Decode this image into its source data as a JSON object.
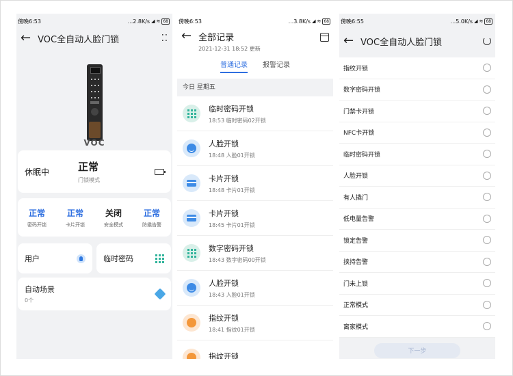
{
  "panel1": {
    "status": {
      "left": "傍晚6:53",
      "right": "...2.8K/s",
      "battery": "68"
    },
    "title": "VOC全自动人脸门锁",
    "brand": "VOC",
    "sleep": {
      "label": "休眠中",
      "value": "正常",
      "sub": "门锁模式"
    },
    "modes": [
      {
        "value": "正常",
        "label": "密码开锁",
        "color": "#2f6fe0"
      },
      {
        "value": "正常",
        "label": "卡片开锁",
        "color": "#2f6fe0"
      },
      {
        "value": "关闭",
        "label": "安全模式",
        "color": "#222222"
      },
      {
        "value": "正常",
        "label": "防撬告警",
        "color": "#2f6fe0"
      }
    ],
    "user": {
      "label": "用户",
      "icon": "user-icon"
    },
    "temp": {
      "label": "临时密码",
      "icon": "grid-icon"
    },
    "scene": {
      "title": "自动场景",
      "count": "0个",
      "icon": "cube-icon"
    }
  },
  "panel2": {
    "status": {
      "left": "傍晚6:53",
      "right": "...3.8K/s",
      "battery": "68"
    },
    "title": "全部记录",
    "updated": "2021-12-31 18:52 更新",
    "tabs": [
      "普通记录",
      "报警记录"
    ],
    "day": "今日 星期五",
    "records": [
      {
        "title": "临时密码开锁",
        "sub": "18:53 临时密码02开锁",
        "icon": "keypad-icon"
      },
      {
        "title": "人脸开锁",
        "sub": "18:48 人脸01开锁",
        "icon": "face-icon"
      },
      {
        "title": "卡片开锁",
        "sub": "18:48 卡片01开锁",
        "icon": "card-icon"
      },
      {
        "title": "卡片开锁",
        "sub": "18:45 卡片01开锁",
        "icon": "card-icon"
      },
      {
        "title": "数字密码开锁",
        "sub": "18:43 数字密码00开锁",
        "icon": "keypad-icon"
      },
      {
        "title": "人脸开锁",
        "sub": "18:43 人脸01开锁",
        "icon": "face-icon"
      },
      {
        "title": "指纹开锁",
        "sub": "18:41 指纹01开锁",
        "icon": "fingerprint-icon"
      },
      {
        "title": "指纹开锁",
        "sub": "",
        "icon": "fingerprint-icon"
      }
    ]
  },
  "panel3": {
    "status": {
      "left": "傍晚6:55",
      "right": "...5.0K/s",
      "battery": "68"
    },
    "title": "VOC全自动人脸门锁",
    "options": [
      "指纹开锁",
      "数字密码开锁",
      "门禁卡开锁",
      "NFC卡开锁",
      "临时密码开锁",
      "人脸开锁",
      "有人撬门",
      "低电量告警",
      "锁定告警",
      "挟持告警",
      "门未上锁",
      "正常模式",
      "离家模式"
    ],
    "next": "下一步"
  }
}
